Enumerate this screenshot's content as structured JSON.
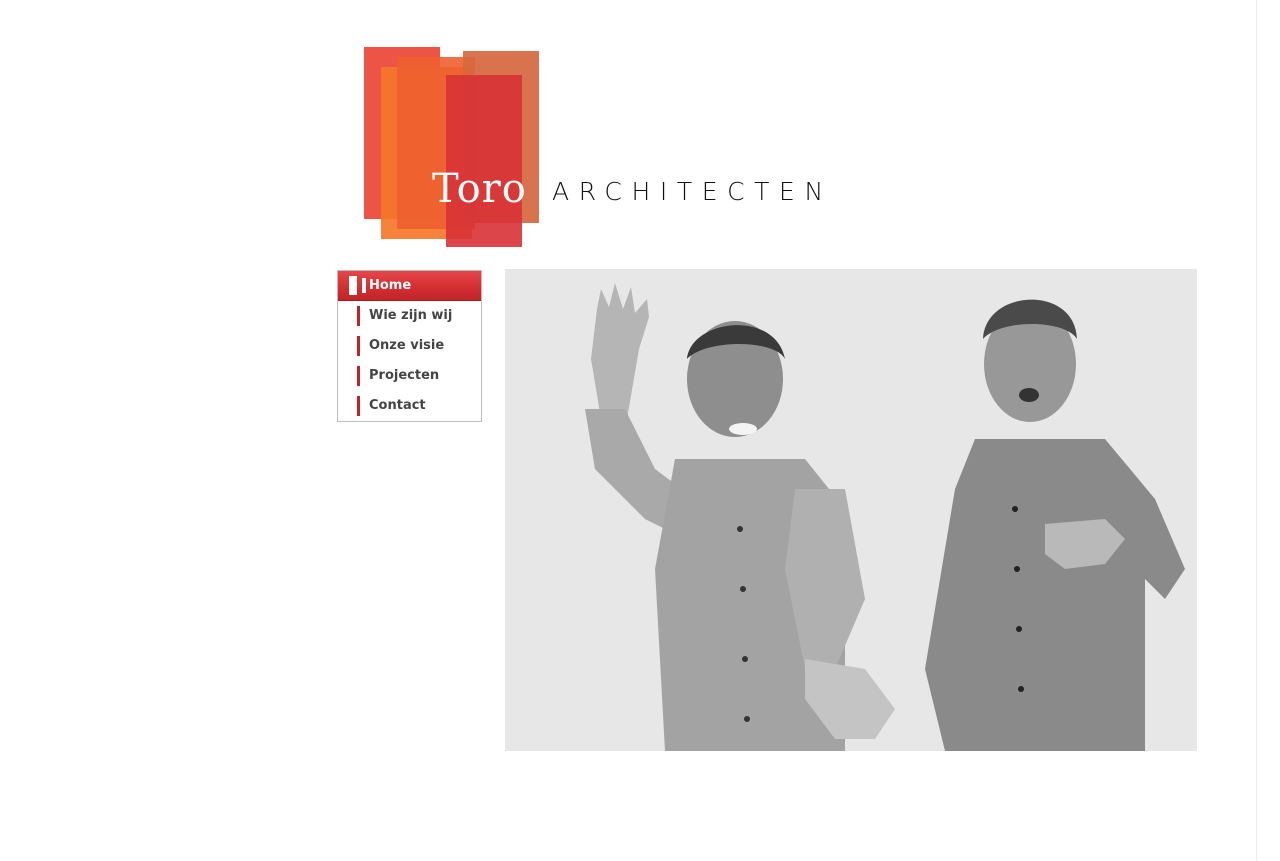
{
  "logo": {
    "wordmark": "Toro",
    "tagline": "ARCHITECTEN",
    "colors": [
      "#ec4b3b",
      "#f5772a",
      "#d6673f",
      "#d83236"
    ]
  },
  "nav": {
    "items": [
      {
        "label": "Home",
        "active": true
      },
      {
        "label": "Wie zijn wij",
        "active": false
      },
      {
        "label": "Onze visie",
        "active": false
      },
      {
        "label": "Projecten",
        "active": false
      },
      {
        "label": "Contact",
        "active": false
      }
    ],
    "accent_color": "#c0232b"
  },
  "hero": {
    "icon": "photo-two-architects"
  }
}
